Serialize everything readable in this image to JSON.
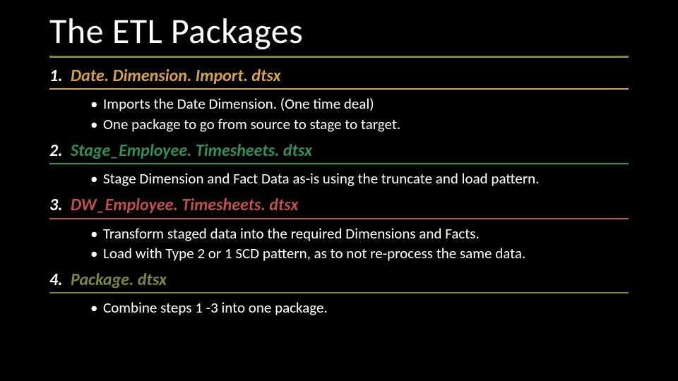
{
  "title": "The ETL Packages",
  "packages": [
    {
      "num": "1.",
      "name": "Date. Dimension. Import. dtsx",
      "bullets": [
        "Imports the Date Dimension. (One time deal)",
        "One package to go from source to stage to target."
      ]
    },
    {
      "num": "2.",
      "name": "Stage_Employee. Timesheets. dtsx",
      "bullets": [
        "Stage Dimension and Fact Data as-is using the truncate and load pattern."
      ]
    },
    {
      "num": "3.",
      "name": "DW_Employee. Timesheets. dtsx",
      "bullets": [
        "Transform staged data into the required Dimensions and Facts.",
        "Load with Type 2 or 1 SCD pattern, as to not re-process the same data."
      ]
    },
    {
      "num": "4.",
      "name": "Package. dtsx",
      "bullets": [
        "Combine steps 1 -3 into one package."
      ]
    }
  ]
}
